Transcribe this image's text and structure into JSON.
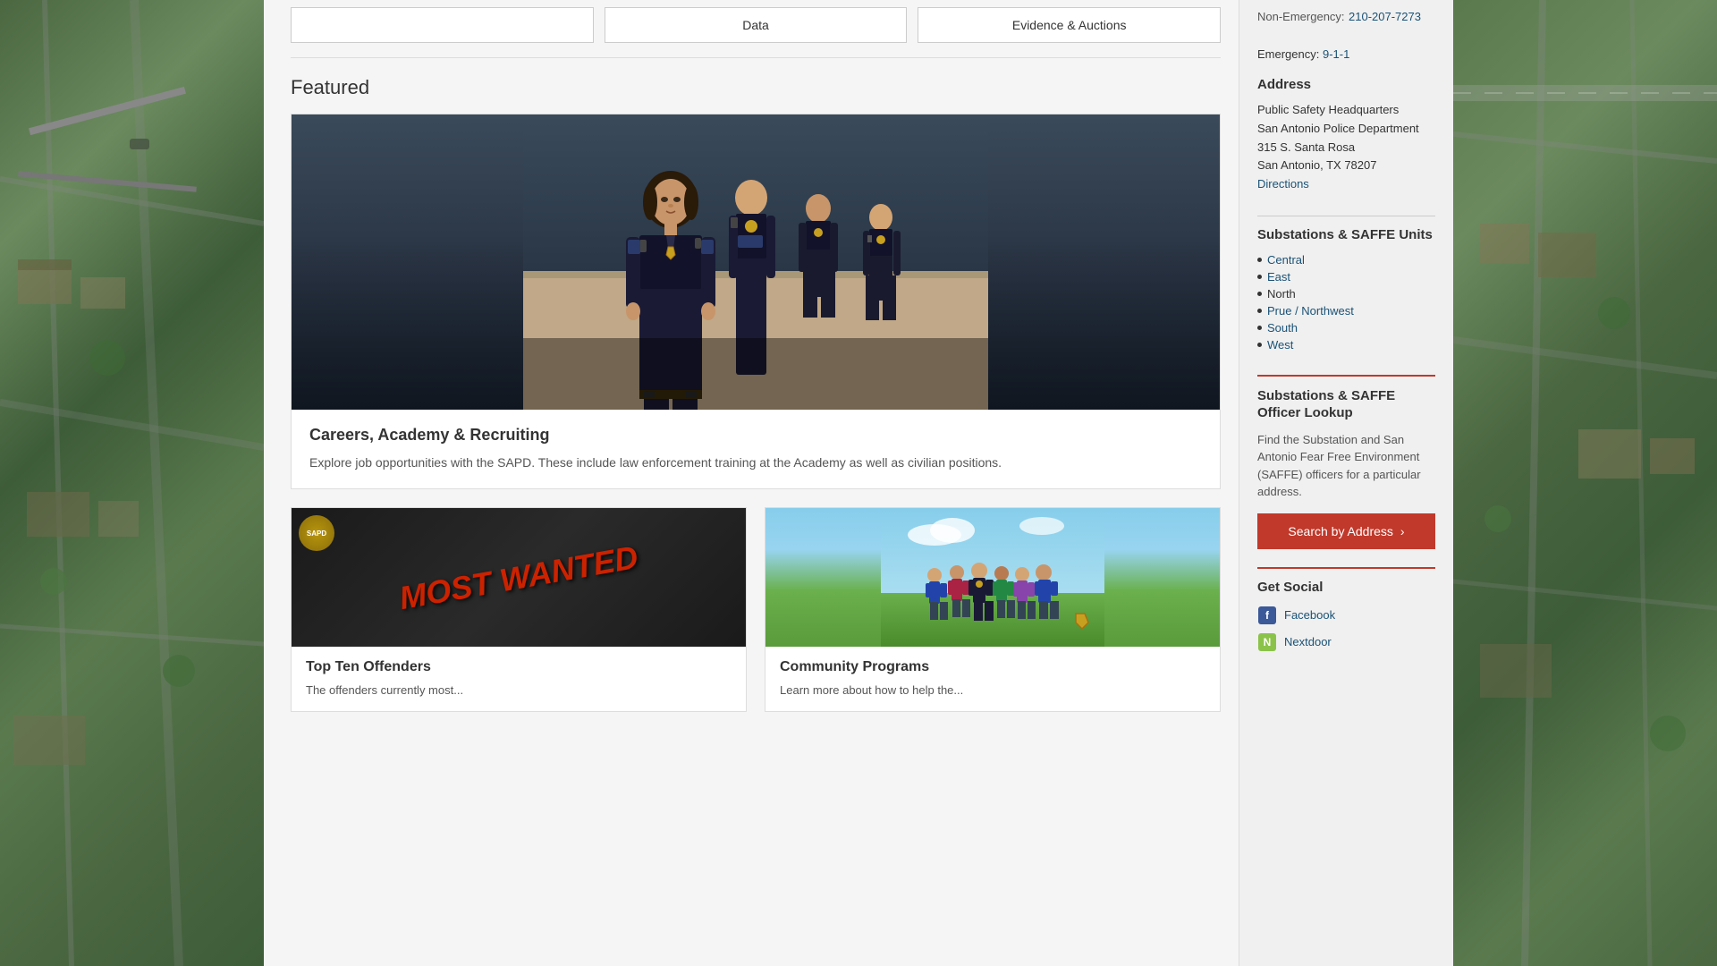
{
  "page": {
    "title": "San Antonio Police Department"
  },
  "background": {
    "left_color": "#4a6741",
    "right_color": "#5a7a4e"
  },
  "top_tabs": [
    {
      "id": "tab1",
      "label": ""
    },
    {
      "id": "tab2",
      "label": "Data"
    },
    {
      "id": "tab3",
      "label": "Evidence & Auctions"
    }
  ],
  "featured": {
    "section_title": "Featured",
    "card": {
      "title": "Careers, Academy & Recruiting",
      "description": "Explore job opportunities with the SAPD. These include law enforcement training at the Academy as well as civilian positions."
    }
  },
  "sub_cards": [
    {
      "id": "most-wanted",
      "image_text": "MOST WANTED",
      "title": "Top Ten Offenders",
      "description": "The offenders currently most..."
    },
    {
      "id": "community",
      "title": "Community Programs",
      "description": "Learn more about how to help the..."
    }
  ],
  "sidebar": {
    "non_emergency": {
      "label": "Non-Emergency:",
      "value": "210-207-7273"
    },
    "emergency": {
      "label": "Emergency:",
      "number": "9-1-1"
    },
    "address_section": {
      "heading": "Address",
      "line1": "Public Safety Headquarters",
      "line2": "San Antonio Police Department",
      "line3": "315 S. Santa Rosa",
      "line4": "San Antonio, TX 78207",
      "directions_link": "Directions"
    },
    "substations": {
      "heading": "Substations & SAFFE Units",
      "items": [
        {
          "id": "central",
          "label": "Central",
          "is_link": true
        },
        {
          "id": "east",
          "label": "East",
          "is_link": true
        },
        {
          "id": "north",
          "label": "North",
          "is_link": false
        },
        {
          "id": "prue-northwest",
          "label": "Prue / Northwest",
          "is_link": true
        },
        {
          "id": "south",
          "label": "South",
          "is_link": true
        },
        {
          "id": "west",
          "label": "West",
          "is_link": true
        }
      ]
    },
    "officer_lookup": {
      "heading": "Substations & SAFFE Officer Lookup",
      "description": "Find the Substation and San Antonio Fear Free Environment (SAFFE) officers for a particular address.",
      "button_label": "Search by Address"
    },
    "get_social": {
      "heading": "Get Social",
      "items": [
        {
          "id": "facebook",
          "label": "Facebook",
          "icon": "f"
        },
        {
          "id": "nextdoor",
          "label": "Nextdoor",
          "icon": "N"
        }
      ]
    }
  }
}
